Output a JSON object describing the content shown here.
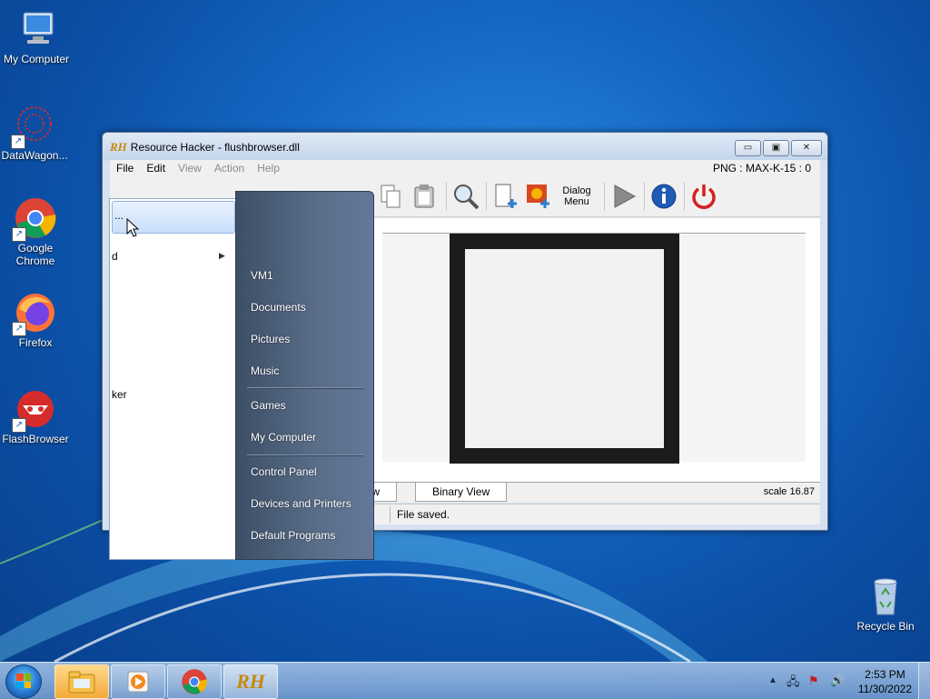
{
  "desktop": {
    "icons": [
      {
        "label": "My Computer"
      },
      {
        "label": "DataWagon..."
      },
      {
        "label": "Google Chrome"
      },
      {
        "label": "Firefox"
      },
      {
        "label": "FlashBrowser"
      },
      {
        "label": "Recycle Bin"
      }
    ]
  },
  "window": {
    "logo": "RH",
    "title": "Resource Hacker - flushbrowser.dll",
    "buttons": {
      "minimize": "▭",
      "restore": "▣",
      "close": "✕"
    },
    "menu": [
      "File",
      "Edit",
      "View",
      "Action",
      "Help"
    ],
    "resource_id": "PNG : MAX-K-15 : 0",
    "toolbar": {
      "dialog_menu_label": "Dialog Menu"
    },
    "tabs": {
      "view_tab": "iew",
      "binary_tab": "Binary View"
    },
    "scale": "scale 16.87",
    "status": "File saved."
  },
  "start_menu": {
    "left_items": [
      {
        "label": "..."
      },
      {
        "label": "d"
      },
      {
        "label": "ker"
      }
    ],
    "right_items": [
      {
        "label": "VM1"
      },
      {
        "label": "Documents"
      },
      {
        "label": "Pictures"
      },
      {
        "label": "Music"
      },
      {
        "label": "Games"
      },
      {
        "label": "My Computer"
      },
      {
        "label": "Control Panel"
      },
      {
        "label": "Devices and Printers"
      },
      {
        "label": "Default Programs"
      }
    ]
  },
  "taskbar": {
    "clock_time": "2:53 PM",
    "clock_date": "11/30/2022",
    "rh_label": "RH"
  },
  "colors": {
    "desktop_bg": "#1567c4",
    "rh_orange": "#c8890d",
    "power_red": "#d42020",
    "info_blue": "#1f5bb5"
  }
}
